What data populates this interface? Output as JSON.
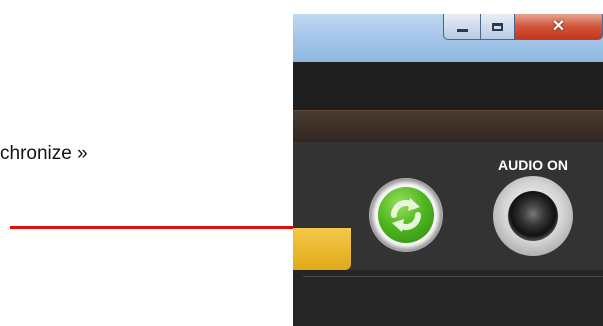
{
  "annotation": {
    "text": "chronize »",
    "arrow_color": "#e30d0d"
  },
  "window": {
    "controls": {
      "minimize_icon": "minimize-icon",
      "maximize_icon": "maximize-icon",
      "close_icon": "close-icon"
    },
    "titlebar_color": "#a9c8ea",
    "close_color": "#d2553a"
  },
  "toolbar": {
    "sync_icon": "sync-icon",
    "sync_color": "#4fb821",
    "audio_label": "AUDIO ON",
    "audio_icon": "speaker-icon",
    "tab_color": "#e0a91a"
  }
}
